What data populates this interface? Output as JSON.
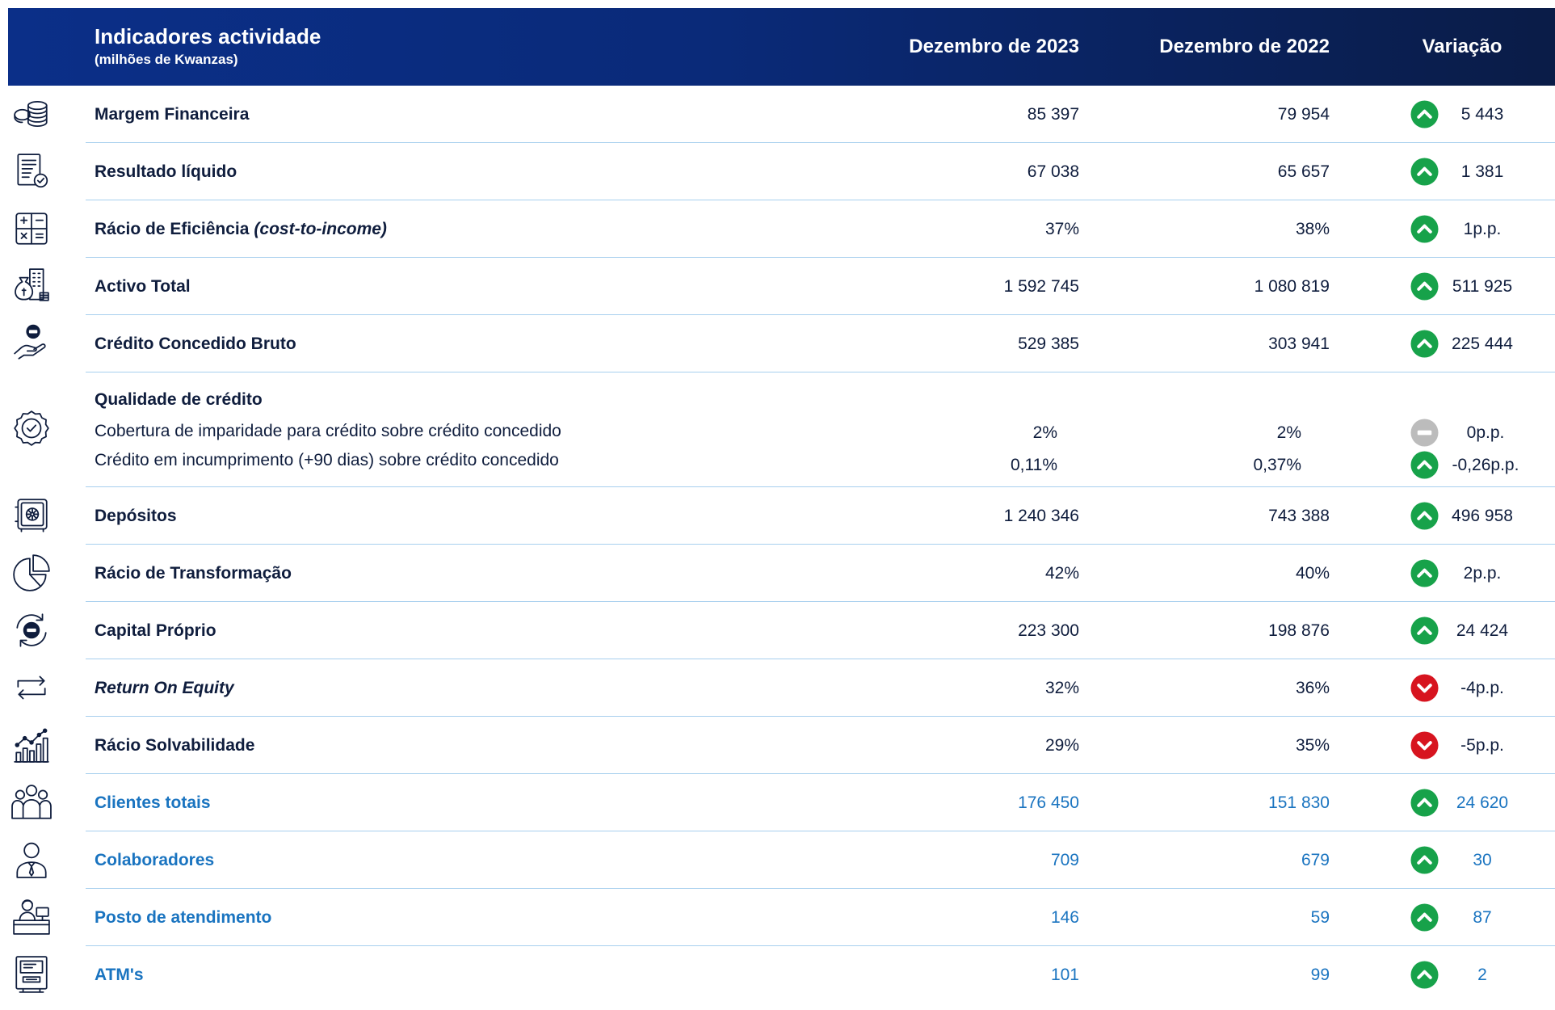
{
  "header": {
    "title": "Indicadores actividade",
    "subtitle": "(milhões de Kwanzas)",
    "col_2023": "Dezembro de 2023",
    "col_2022": "Dezembro de 2022",
    "col_variation": "Variação"
  },
  "rows": [
    {
      "icon": "coins-icon",
      "label": "Margem Financeira",
      "v2023": "85 397",
      "v2022": "79 954",
      "variation": "5 443",
      "trend": "up"
    },
    {
      "icon": "receipt-check-icon",
      "label": "Resultado líquido",
      "v2023": "67 038",
      "v2022": "65 657",
      "variation": "1 381",
      "trend": "up"
    },
    {
      "icon": "calculator-icon",
      "label": "Rácio de Eficiência",
      "label_italic": "(cost-to-income)",
      "v2023": "37%",
      "v2022": "38%",
      "variation": "1p.p.",
      "trend": "up"
    },
    {
      "icon": "money-bag-building-icon",
      "label": "Activo Total",
      "v2023": "1 592 745",
      "v2022": "1 080 819",
      "variation": "511 925",
      "trend": "up"
    },
    {
      "icon": "hand-coin-icon",
      "label": "Crédito Concedido Bruto",
      "v2023": "529 385",
      "v2022": "303 941",
      "variation": "225 444",
      "trend": "up"
    },
    {
      "icon": "safe-icon",
      "label": "Depósitos",
      "v2023": "1 240 346",
      "v2022": "743 388",
      "variation": "496 958",
      "trend": "up"
    },
    {
      "icon": "pie-chart-icon",
      "label": "Rácio de Transformação",
      "v2023": "42%",
      "v2022": "40%",
      "variation": "2p.p.",
      "trend": "up"
    },
    {
      "icon": "coin-refresh-icon",
      "label": "Capital Próprio",
      "v2023": "223 300",
      "v2022": "198 876",
      "variation": "24 424",
      "trend": "up"
    },
    {
      "icon": "repeat-arrows-icon",
      "label": "Return On Equity",
      "v2023": "32%",
      "v2022": "36%",
      "variation": "-4p.p.",
      "trend": "down"
    },
    {
      "icon": "growth-chart-icon",
      "label": "Rácio Solvabilidade",
      "v2023": "29%",
      "v2022": "35%",
      "variation": "-5p.p.",
      "trend": "down"
    },
    {
      "icon": "people-group-icon",
      "label": "Clientes totais",
      "v2023": "176 450",
      "v2022": "151 830",
      "variation": "24 620",
      "trend": "up"
    },
    {
      "icon": "user-tie-icon",
      "label": "Colaboradores",
      "v2023": "709",
      "v2022": "679",
      "variation": "30",
      "trend": "up"
    },
    {
      "icon": "service-desk-icon",
      "label": "Posto de atendimento",
      "v2023": "146",
      "v2022": "59",
      "variation": "87",
      "trend": "up"
    },
    {
      "icon": "atm-icon",
      "label": "ATM's",
      "v2023": "101",
      "v2022": "99",
      "variation": "2",
      "trend": "up"
    }
  ],
  "credit_quality": {
    "icon": "badge-check-icon",
    "title": "Qualidade de crédito",
    "items": [
      {
        "label": "Cobertura de imparidade para crédito sobre crédito concedido",
        "v2023": "2%",
        "v2022": "2%",
        "variation": "0p.p.",
        "trend": "neutral"
      },
      {
        "label": "Crédito em incumprimento (+90 dias) sobre crédito concedido",
        "v2023": "0,11%",
        "v2022": "0,37%",
        "variation": "-0,26p.p.",
        "trend": "up"
      }
    ]
  },
  "colors": {
    "header_start": "#0b2f88",
    "header_end": "#0a1c47",
    "text": "#0f1d3d",
    "text_blue": "#1a74c0",
    "trend_up": "#17a24a",
    "trend_down": "#d7141f",
    "trend_neutral": "#bcbcbc",
    "row_rule": "#a7cfee"
  }
}
